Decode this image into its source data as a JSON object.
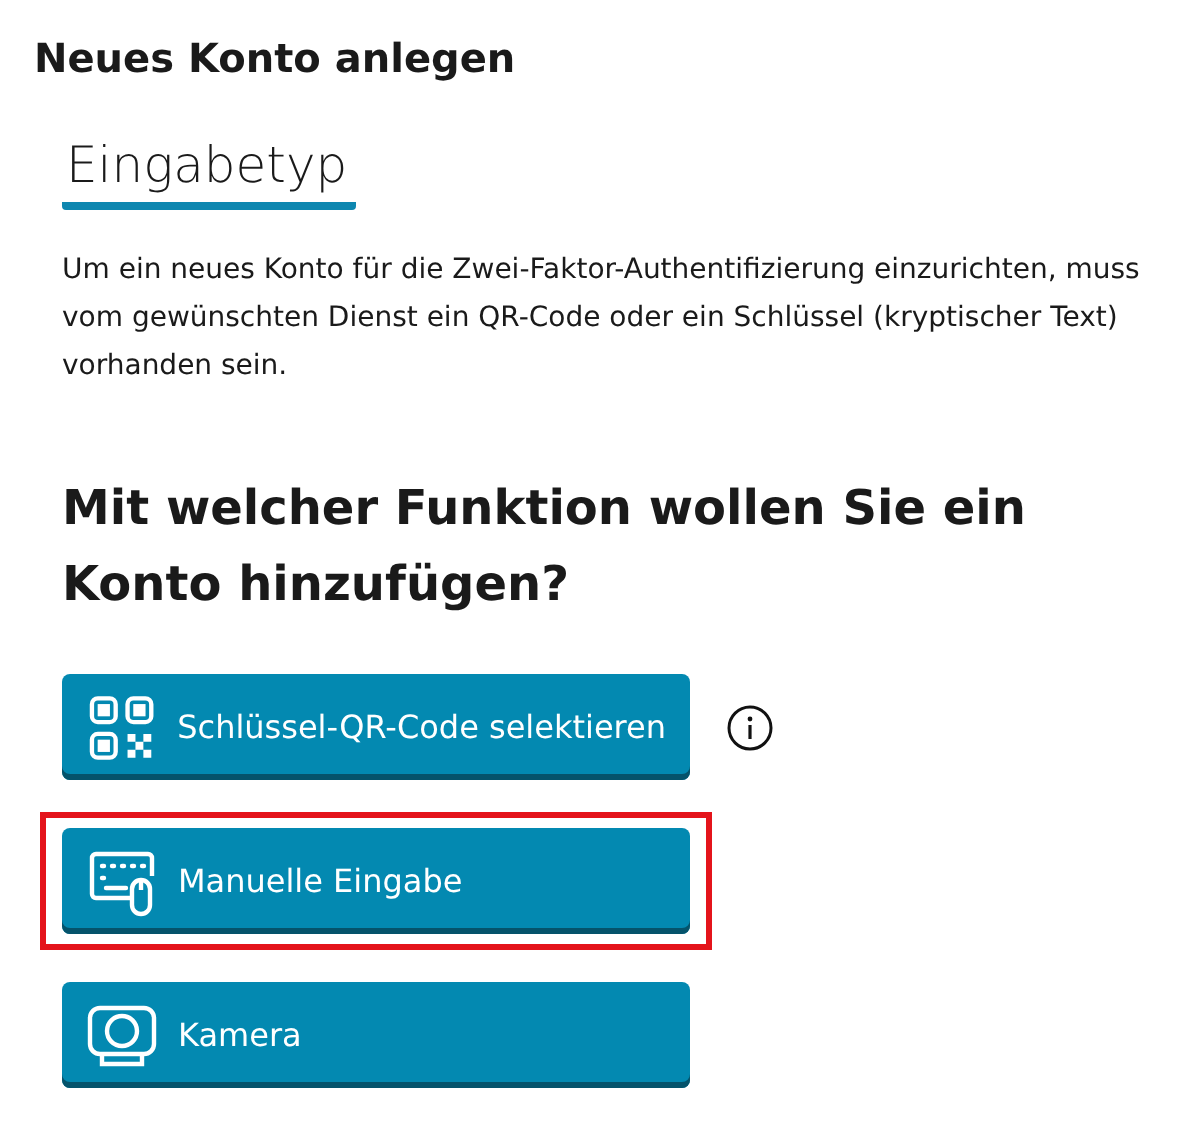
{
  "window": {
    "title": "Neues Konto anlegen"
  },
  "tabs": [
    {
      "label": "Eingabetyp",
      "selected": true
    }
  ],
  "description": "Um ein neues Konto für die Zwei-Faktor-Authentifizierung einzurichten, muss vom gewünschten Dienst ein QR-Code oder ein Schlüssel (kryptischer Text) vorhanden sein.",
  "question": "Mit welcher Funktion wollen Sie ein Konto hinzufügen?",
  "options": [
    {
      "kind": "qr",
      "label": "Schlüssel-QR-Code selektieren",
      "info": true,
      "highlighted": false
    },
    {
      "kind": "keyboard",
      "label": "Manuelle Eingabe",
      "info": false,
      "highlighted": true
    },
    {
      "kind": "camera",
      "label": "Kamera",
      "info": false,
      "highlighted": false
    }
  ]
}
